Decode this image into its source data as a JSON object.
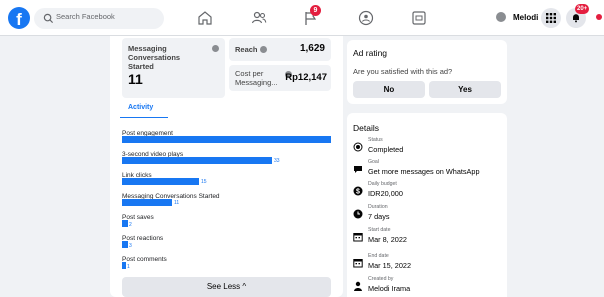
{
  "topbar": {
    "logo": "f",
    "search_placeholder": "Search Facebook",
    "nav_icons": [
      "home-icon",
      "friends-icon",
      "flag-icon",
      "groups-icon",
      "gaming-icon"
    ],
    "nav_badge": "9",
    "profile_name": "Melodi",
    "notifications_badge": "20+"
  },
  "stats": {
    "conversations_label": "Messaging Conversations Started",
    "conversations_value": "11",
    "reach_label": "Reach",
    "reach_value": "1,629",
    "cost_label": "Cost per Messaging...",
    "cost_value": "Rp12,147"
  },
  "activity": {
    "tab_label": "Activity",
    "metrics": [
      {
        "label": "Post engagement",
        "value": "",
        "fraction": 1.0
      },
      {
        "label": "3-second video plays",
        "value": "33",
        "fraction": 0.72
      },
      {
        "label": "Link clicks",
        "value": "15",
        "fraction": 0.37
      },
      {
        "label": "Messaging Conversations Started",
        "value": "11",
        "fraction": 0.24
      },
      {
        "label": "Post saves",
        "value": "2",
        "fraction": 0.03
      },
      {
        "label": "Post reactions",
        "value": "3",
        "fraction": 0.03
      },
      {
        "label": "Post comments",
        "value": "1",
        "fraction": 0.02
      }
    ],
    "see_less": "See Less ^"
  },
  "ad_rating": {
    "title": "Ad rating",
    "question": "Are you satisfied with this ad?",
    "no_label": "No",
    "yes_label": "Yes"
  },
  "details": {
    "title": "Details",
    "rows": [
      {
        "key": "Status",
        "value": "Completed",
        "icon": "radio-icon"
      },
      {
        "key": "Goal",
        "value": "Get more messages on WhatsApp",
        "icon": "chat-icon"
      },
      {
        "key": "Daily budget",
        "value": "IDR20,000",
        "icon": "money-icon"
      },
      {
        "key": "Duration",
        "value": "7 days",
        "icon": "clock-icon"
      },
      {
        "key": "Start date",
        "value": "Mar 8, 2022",
        "icon": "calendar-icon"
      },
      {
        "key": "End date",
        "value": "Mar 15, 2022",
        "icon": "calendar-icon"
      },
      {
        "key": "Created by",
        "value": "Melodi Irama",
        "icon": "person-icon"
      }
    ]
  }
}
